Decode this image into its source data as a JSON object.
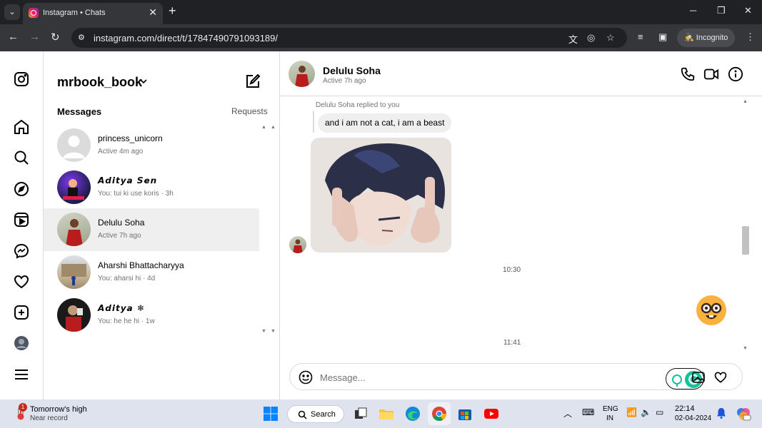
{
  "browser": {
    "tab_title": "Instagram • Chats",
    "url": "instagram.com/direct/t/17847490791093189/",
    "incognito_label": "Incognito"
  },
  "sidebar": {
    "account_name": "mrbook_book",
    "messages_heading": "Messages",
    "requests_label": "Requests",
    "conversations": [
      {
        "name": "princess_unicorn",
        "sub": "Active 4m ago",
        "selected": false
      },
      {
        "name": "𝘼𝙙𝙞𝙩𝙮𝙖 𝙎𝙚𝙣",
        "sub": "You: tui ki use koris · 3h",
        "selected": false
      },
      {
        "name": "Delulu Soha",
        "sub": "Active 7h ago",
        "selected": true
      },
      {
        "name": "Aharshi Bhattacharyya",
        "sub": "You: aharsi hi · 4d",
        "selected": false
      },
      {
        "name": "𝘼𝙙𝙞𝙩𝙮𝙖 ❄",
        "sub": "You: he he hi · 1w",
        "selected": false
      }
    ]
  },
  "chat": {
    "contact_name": "Delulu Soha",
    "contact_status": "Active 7h ago",
    "reply_note": "Delulu Soha replied to you",
    "reply_quote": "and i am not a cat, i am a beast",
    "time_1": "10:30",
    "time_2": "11:41",
    "composer_placeholder": "Message..."
  },
  "taskbar": {
    "weather_title": "Tomorrow's high",
    "weather_sub": "Near record",
    "weather_badge": "1",
    "search_label": "Search",
    "lang_1": "ENG",
    "lang_2": "IN",
    "clock_time": "22:14",
    "clock_date": "02-04-2024"
  },
  "colors": {
    "browser_dark": "#202124",
    "browser_toolbar": "#35363a",
    "border": "#dbdbdb",
    "selected_row": "#efefef",
    "muted_text": "#737373",
    "taskbar": "#dfe3ee"
  }
}
